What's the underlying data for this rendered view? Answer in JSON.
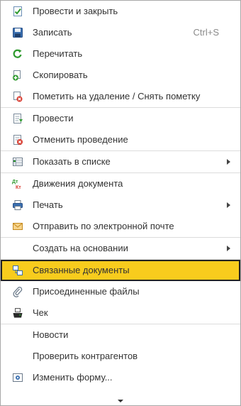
{
  "menu": {
    "groups": [
      {
        "items": [
          {
            "label": "Провести и закрыть",
            "icon": "post-and-close-icon"
          },
          {
            "label": "Записать",
            "shortcut": "Ctrl+S",
            "icon": "save-icon"
          },
          {
            "label": "Перечитать",
            "icon": "reread-icon"
          },
          {
            "label": "Скопировать",
            "icon": "copy-icon"
          },
          {
            "label": "Пометить на удаление / Снять пометку",
            "icon": "mark-deletion-icon"
          }
        ]
      },
      {
        "items": [
          {
            "label": "Провести",
            "icon": "post-icon"
          },
          {
            "label": "Отменить проведение",
            "icon": "unpost-icon"
          }
        ]
      },
      {
        "items": [
          {
            "label": "Показать в списке",
            "icon": "show-in-list-icon",
            "submenu": true
          }
        ]
      },
      {
        "items": [
          {
            "label": "Движения документа",
            "icon": "dt-kt-icon",
            "icon_text_dt": "Дт",
            "icon_text_kt": "Кт"
          },
          {
            "label": "Печать",
            "icon": "print-icon",
            "submenu": true
          },
          {
            "label": "Отправить по электронной почте",
            "icon": "email-icon"
          }
        ]
      },
      {
        "items": [
          {
            "label": "Создать на основании",
            "submenu": true
          }
        ]
      },
      {
        "items": [
          {
            "label": "Связанные документы",
            "icon": "related-documents-icon",
            "selected": true
          },
          {
            "label": "Присоединенные файлы",
            "icon": "attachment-icon"
          },
          {
            "label": "Чек",
            "icon": "receipt-printer-icon"
          }
        ]
      },
      {
        "items": [
          {
            "label": "Новости"
          },
          {
            "label": "Проверить контрагентов"
          },
          {
            "label": "Изменить форму...",
            "icon": "change-form-icon"
          }
        ]
      }
    ],
    "colors": {
      "selected_bg": "#f8cc1d",
      "selected_border": "#222222",
      "separator": "#dcdcdc",
      "text": "#333333"
    }
  }
}
